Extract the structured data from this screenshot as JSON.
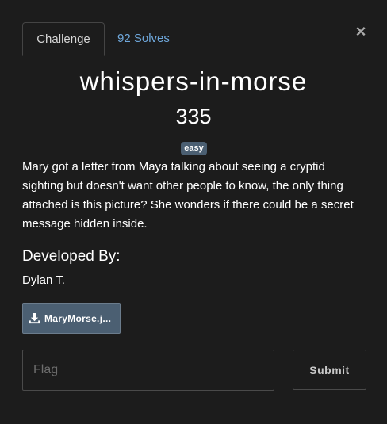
{
  "tabs": {
    "challenge_label": "Challenge",
    "solves_label": "92 Solves"
  },
  "close_symbol": "×",
  "challenge": {
    "title": "whispers-in-morse",
    "points": "335",
    "difficulty": "easy",
    "description": "Mary got a letter from Maya talking about seeing a cryptid sighting but doesn't want other people to know, the only thing attached is this picture? She wonders if there could be a secret message hidden inside.",
    "developer_heading": "Developed By:",
    "developer_name": "Dylan T."
  },
  "file": {
    "label": "MaryMorse.j...",
    "icon": "download-icon"
  },
  "form": {
    "flag_placeholder": "Flag",
    "flag_value": "",
    "submit_label": "Submit"
  },
  "colors": {
    "background": "#1c1c1c",
    "link": "#6fa8dc",
    "badge": "#4b5f72",
    "border": "#4a4a4a"
  }
}
